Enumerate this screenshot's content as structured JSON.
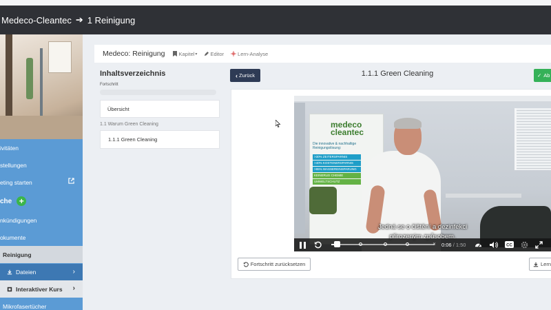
{
  "topbar": {
    "course": "Medeco-Cleantec",
    "arrow": "➔",
    "lesson": "1 Reinigung"
  },
  "sidebar": {
    "items": [
      {
        "label": "ivitäten"
      },
      {
        "label": "stellungen"
      },
      {
        "label": "eting starten",
        "external": true
      }
    ],
    "section_head": "che",
    "section_items": [
      {
        "label": "nkündigungen"
      },
      {
        "label": "okumente"
      }
    ],
    "active": "Reinigung",
    "sub_dateien": "Dateien",
    "sub_kurs": "Interaktiver Kurs",
    "last": "Mikrofasertücher"
  },
  "header": {
    "title": "Medeco: Reinigung",
    "links": [
      {
        "label": "Kapitel",
        "icon": "bookmark-icon",
        "dropdown": true
      },
      {
        "label": "Editor",
        "icon": "pencil-icon"
      },
      {
        "label": "Lern-Analyse",
        "icon": "analytics-icon"
      }
    ]
  },
  "toc": {
    "heading": "Inhaltsverzeichnis",
    "progress_label": "Fortschritt",
    "progress": 0,
    "overview": "Übersicht",
    "section": "1.1 Warum Green Cleaning",
    "lesson": "1.1.1 Green Cleaning"
  },
  "lesson": {
    "back_label": "Zurück",
    "title": "1.1.1 Green Cleaning",
    "next_label": "Ab",
    "reset_label": "Fortschritt zurücksetzen",
    "download_label": "Lern"
  },
  "video": {
    "logo_line1": "medeco",
    "logo_line2": "cleantec",
    "banner_lines": [
      "Die innovative & nachhaltige",
      "Reinigungslösung:",
      ">30% ZEITERSPARNIS",
      ">40% KOSTENERSPARNIS",
      ">95% WASSEREINSPARUNG",
      "KEINERLEI CHEMIE",
      "UMWELTSCHUTZ"
    ],
    "subtitle_line1": "Jedná se o čištění a dezinfekci",
    "subtitle_line2": "přirozeným způsobem.",
    "current_time": "0:06",
    "duration": "1:50",
    "progress_fraction": 0.055
  }
}
